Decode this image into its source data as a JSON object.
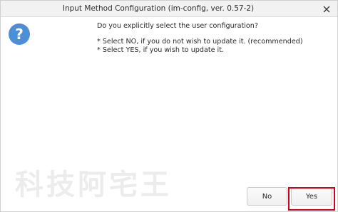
{
  "window": {
    "title": "Input Method Configuration (im-config, ver. 0.57-2)"
  },
  "dialog": {
    "icon": "question-icon",
    "question": "Do you explicitly select the user configuration?",
    "option_no": "* Select NO, if you do not wish to update it. (recommended)",
    "option_yes": "* Select YES, if you wish to update it."
  },
  "buttons": {
    "no_label": "No",
    "yes_label": "Yes"
  },
  "watermark": {
    "text": "科技阿宅王"
  },
  "colors": {
    "accent_icon": "#4d8fd6",
    "highlight": "#d0021b"
  }
}
